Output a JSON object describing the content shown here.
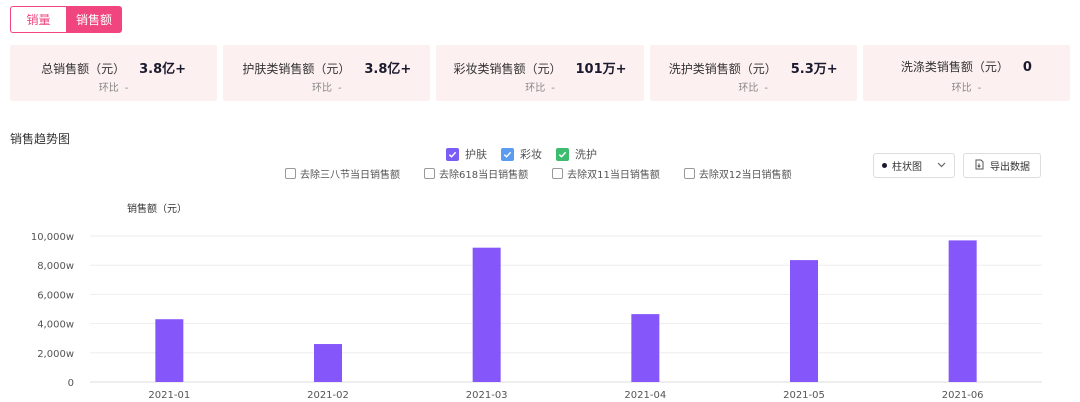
{
  "toggle": {
    "options": [
      "销量",
      "销售额"
    ],
    "active_index": 1
  },
  "cards": [
    {
      "label": "总销售额（元）",
      "value": "3.8亿+",
      "mom_label": "环比",
      "mom_value": "-"
    },
    {
      "label": "护肤类销售额（元）",
      "value": "3.8亿+",
      "mom_label": "环比",
      "mom_value": "-"
    },
    {
      "label": "彩妆类销售额（元）",
      "value": "101万+",
      "mom_label": "环比",
      "mom_value": "-"
    },
    {
      "label": "洗护类销售额（元）",
      "value": "5.3万+",
      "mom_label": "环比",
      "mom_value": "-"
    },
    {
      "label": "洗涤类销售额（元）",
      "value": "0",
      "mom_label": "环比",
      "mom_value": "-"
    }
  ],
  "section_title": "销售趋势图",
  "legend": [
    {
      "name": "护肤",
      "color": "#7b5cf5",
      "checked": true
    },
    {
      "name": "彩妆",
      "color": "#5b9bf0",
      "checked": true
    },
    {
      "name": "洗护",
      "color": "#3dbb6e",
      "checked": true
    }
  ],
  "filters": [
    "去除三八节当日销售额",
    "去除618当日销售额",
    "去除双11当日销售额",
    "去除双12当日销售额"
  ],
  "chart_type_select": {
    "value": "柱状图"
  },
  "export_label": "导出数据",
  "colors": {
    "accent": "#f0457f",
    "bar": "#8557fb",
    "card_bg": "#fdf0f0"
  },
  "chart_data": {
    "type": "bar",
    "ylabel": "销售额（元）",
    "categories": [
      "2021-01",
      "2021-02",
      "2021-03",
      "2021-04",
      "2021-05",
      "2021-06"
    ],
    "values": [
      4300,
      2600,
      9200,
      4650,
      8350,
      9700
    ],
    "yticks": [
      0,
      2000,
      4000,
      6000,
      8000,
      10000
    ],
    "ytick_labels": [
      "0",
      "2,000w",
      "4,000w",
      "6,000w",
      "8,000w",
      "10,000w"
    ],
    "ylim": [
      0,
      10000
    ],
    "grid": true
  }
}
